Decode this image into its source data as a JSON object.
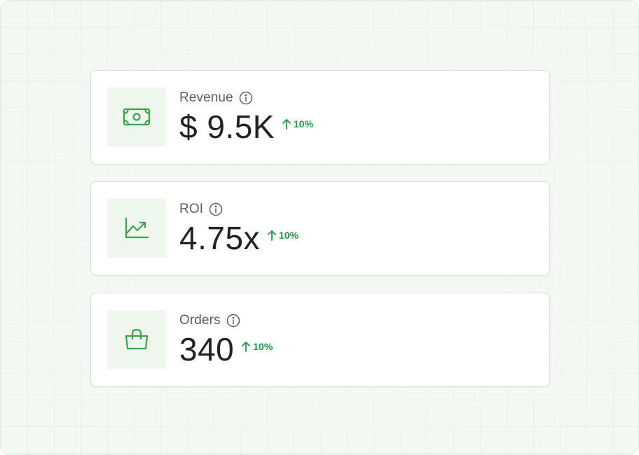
{
  "colors": {
    "accent_green": "#3fa34d",
    "delta_green": "#1f9a4a",
    "icon_bg": "#eef6ee",
    "card_border": "#d9ddd9",
    "background": "#f3f8f2"
  },
  "metrics": [
    {
      "label": "Revenue",
      "value": "$ 9.5K",
      "delta": "10%",
      "icon": "banknote-icon"
    },
    {
      "label": "ROI",
      "value": "4.75x",
      "delta": "10%",
      "icon": "trending-up-chart-icon"
    },
    {
      "label": "Orders",
      "value": "340",
      "delta": "10%",
      "icon": "shopping-bag-icon"
    }
  ]
}
